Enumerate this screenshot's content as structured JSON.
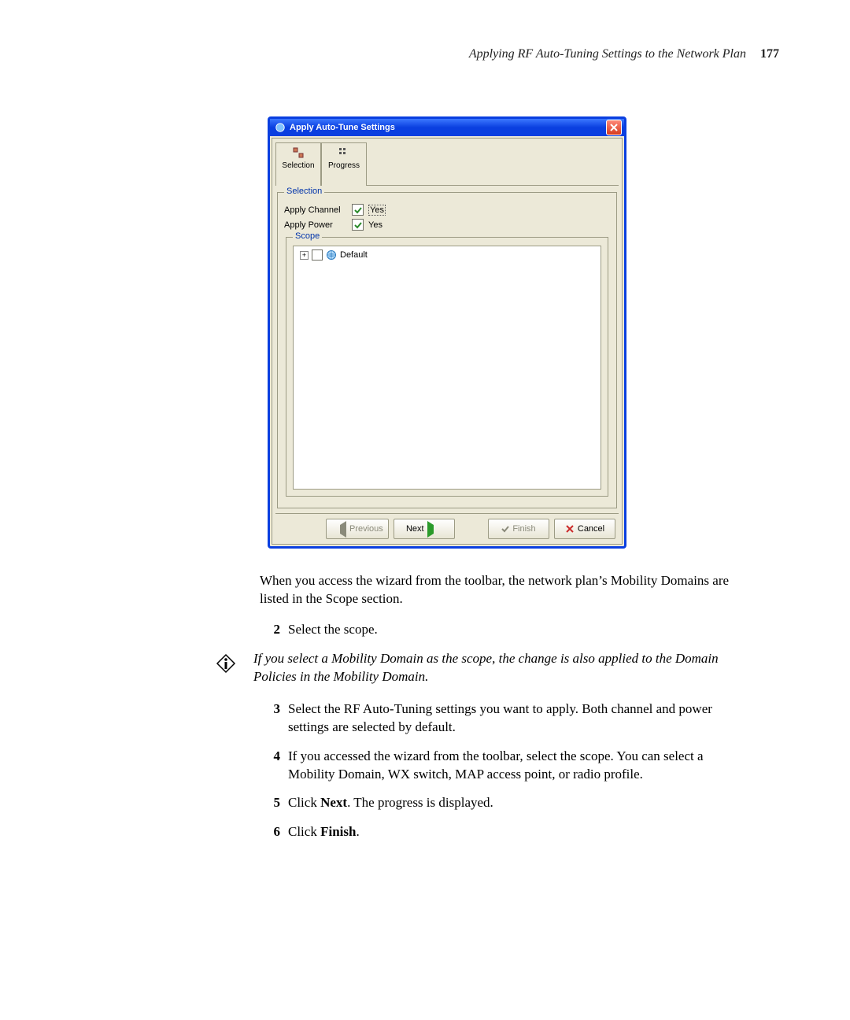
{
  "header": {
    "running": "Applying RF Auto-Tuning Settings to the Network Plan",
    "page_number": "177"
  },
  "dialog": {
    "title": "Apply Auto-Tune Settings",
    "tabs": {
      "selection": "Selection",
      "progress": "Progress"
    },
    "selection": {
      "legend": "Selection",
      "apply_channel_label": "Apply Channel",
      "apply_channel_value": "Yes",
      "apply_power_label": "Apply Power",
      "apply_power_value": "Yes"
    },
    "scope": {
      "legend": "Scope",
      "items": [
        {
          "label": "Default"
        }
      ]
    },
    "buttons": {
      "previous": "Previous",
      "next": "Next",
      "finish": "Finish",
      "cancel": "Cancel"
    }
  },
  "body": {
    "intro": "When you access the wizard from the toolbar, the network plan’s Mobility Domains are listed in the Scope section.",
    "steps": {
      "s2_num": "2",
      "s2": "Select the scope.",
      "note": "If you select a Mobility Domain as the scope, the change is also applied to the Domain Policies in the Mobility Domain.",
      "s3_num": "3",
      "s3": "Select the RF Auto-Tuning settings you want to apply. Both channel and power settings are selected by default.",
      "s4_num": "4",
      "s4": "If you accessed the wizard from the toolbar, select the scope. You can select a Mobility Domain, WX switch, MAP access point, or radio profile.",
      "s5_num": "5",
      "s5_a": "Click ",
      "s5_b": "Next",
      "s5_c": ". The progress is displayed.",
      "s6_num": "6",
      "s6_a": "Click ",
      "s6_b": "Finish",
      "s6_c": "."
    }
  }
}
